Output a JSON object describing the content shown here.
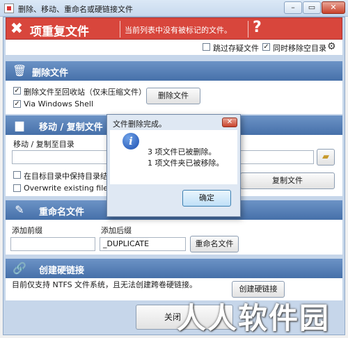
{
  "window": {
    "title": "删除、移动、重命名或硬链接文件"
  },
  "banner": {
    "title": "项重复文件",
    "status": "当前列表中没有被标记的文件。",
    "help": "?"
  },
  "options": {
    "skip_label": "跳过存疑文件",
    "skip_checked": false,
    "remove_empty_label": "同时移除空目录",
    "remove_empty_checked": true
  },
  "delete_section": {
    "title": "删除文件",
    "recycle_label": "删除文件至回收站（仅未压缩文件）",
    "shell_label": "Via Windows Shell",
    "button": "删除文件"
  },
  "move_section": {
    "title": "移动 / 复制文件",
    "target_label": "移动 / 复制至目录",
    "target_value": "",
    "keep_structure_label": "在目标目录中保持目录结构",
    "overwrite_label": "Overwrite existing files",
    "copy_button": "复制文件"
  },
  "rename_section": {
    "title": "重命名文件",
    "prefix_label": "添加前缀",
    "prefix_value": "",
    "suffix_label": "添加后缀",
    "suffix_value": "_DUPLICATE",
    "button": "重命名文件"
  },
  "hardlink_section": {
    "title": "创建硬链接",
    "note": "目前仅支持 NTFS 文件系统，且无法创建跨卷硬链接。",
    "button": "创建硬链接"
  },
  "footer": {
    "close_button": "关闭"
  },
  "dialog": {
    "title": "文件删除完成。",
    "line1": "3 项文件已被删除。",
    "line2": "1 项文件夹已被移除。",
    "ok": "确定"
  },
  "watermark": "人人软件园",
  "colors": {
    "banner": "#d8463c",
    "section_header": "#4f79b0"
  }
}
